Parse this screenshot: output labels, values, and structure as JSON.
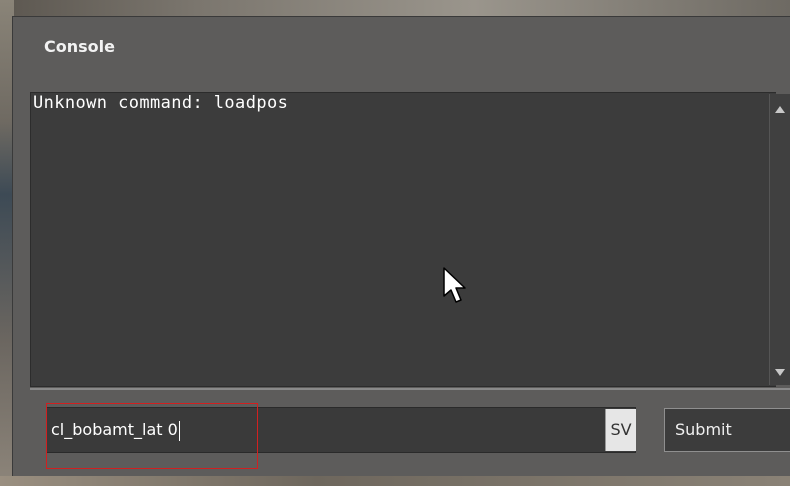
{
  "console": {
    "title": "Console",
    "output_lines": [
      "Unknown command: loadpos"
    ],
    "input_value": "cl_bobamt_lat 0",
    "suggestion_badge": "SV",
    "submit_label": "Submit"
  },
  "colors": {
    "window_bg": "#5d5c5b",
    "panel_bg": "#3c3c3c",
    "text": "#ffffff",
    "highlight": "#d12020"
  },
  "icons": [
    "mouse-pointer-icon",
    "scroll-up-icon",
    "scroll-down-icon"
  ]
}
